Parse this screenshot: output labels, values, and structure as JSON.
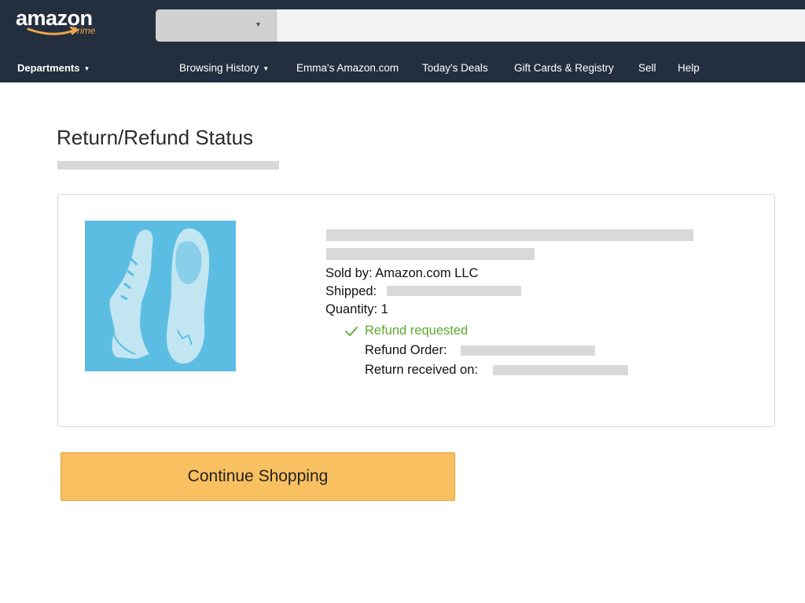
{
  "header": {
    "logo": {
      "wordmark": "amazon",
      "subtitle": "Prime"
    },
    "search": {
      "department_value": "",
      "query": ""
    },
    "departments_label": "Departments",
    "nav_links": [
      {
        "label": "Browsing History",
        "has_dropdown": true
      },
      {
        "label": "Emma's Amazon.com",
        "has_dropdown": false
      },
      {
        "label": "Today's Deals",
        "has_dropdown": false
      },
      {
        "label": "Gift Cards & Registry",
        "has_dropdown": false
      },
      {
        "label": "Sell",
        "has_dropdown": false
      },
      {
        "label": "Help",
        "has_dropdown": false
      }
    ]
  },
  "page": {
    "title": "Return/Refund Status"
  },
  "item": {
    "image": "shoes-product-image",
    "sold_by": "Sold by: Amazon.com LLC",
    "shipped_label": "Shipped:",
    "quantity": "Quantity: 1",
    "refund_status": "Refund requested",
    "refund_order_label": "Refund Order:",
    "return_received_label": "Return received on:"
  },
  "actions": {
    "continue_label": "Continue Shopping"
  },
  "colors": {
    "header_bg": "#232f3e",
    "accent_orange": "#f8c060",
    "status_green": "#5ea832",
    "redaction_gray": "#d9d9d9",
    "product_bg": "#5cbde2"
  }
}
